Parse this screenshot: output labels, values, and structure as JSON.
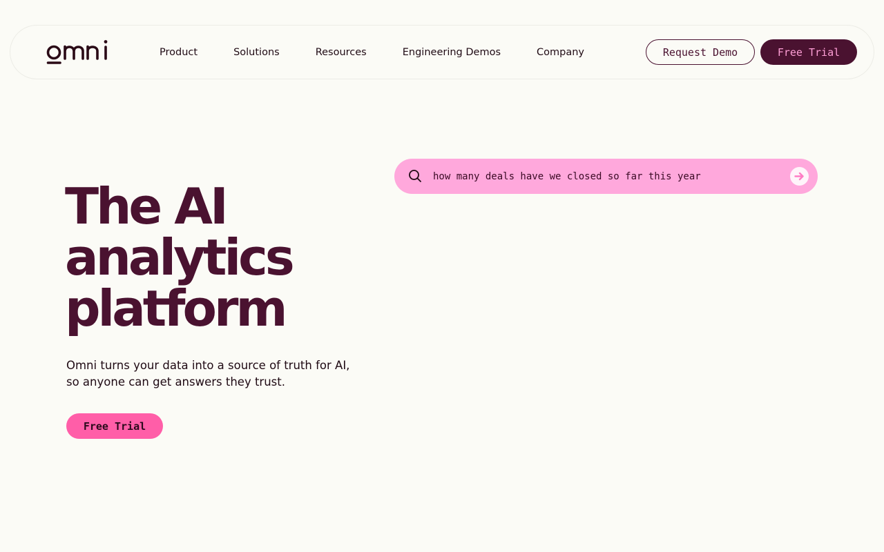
{
  "nav": {
    "logo_text": "omni",
    "links": [
      "Product",
      "Solutions",
      "Resources",
      "Engineering Demos",
      "Company"
    ],
    "request_demo": "Request Demo",
    "free_trial": "Free Trial"
  },
  "hero": {
    "title_lines": [
      "The AI",
      "analytics",
      "platform"
    ],
    "subtitle_lines": [
      "Omni turns your data into a source of truth for AI,",
      "so anyone can get answers they trust."
    ],
    "cta": "Free Trial"
  },
  "search": {
    "query": "how many deals have we closed so far this year",
    "icon": "search-icon",
    "submit_icon": "arrow-right-icon"
  },
  "colors": {
    "background": "#fbfbf6",
    "brand_dark": "#4a1230",
    "brand_pink": "#ff5ea8",
    "search_pink": "#ffa8dc"
  }
}
